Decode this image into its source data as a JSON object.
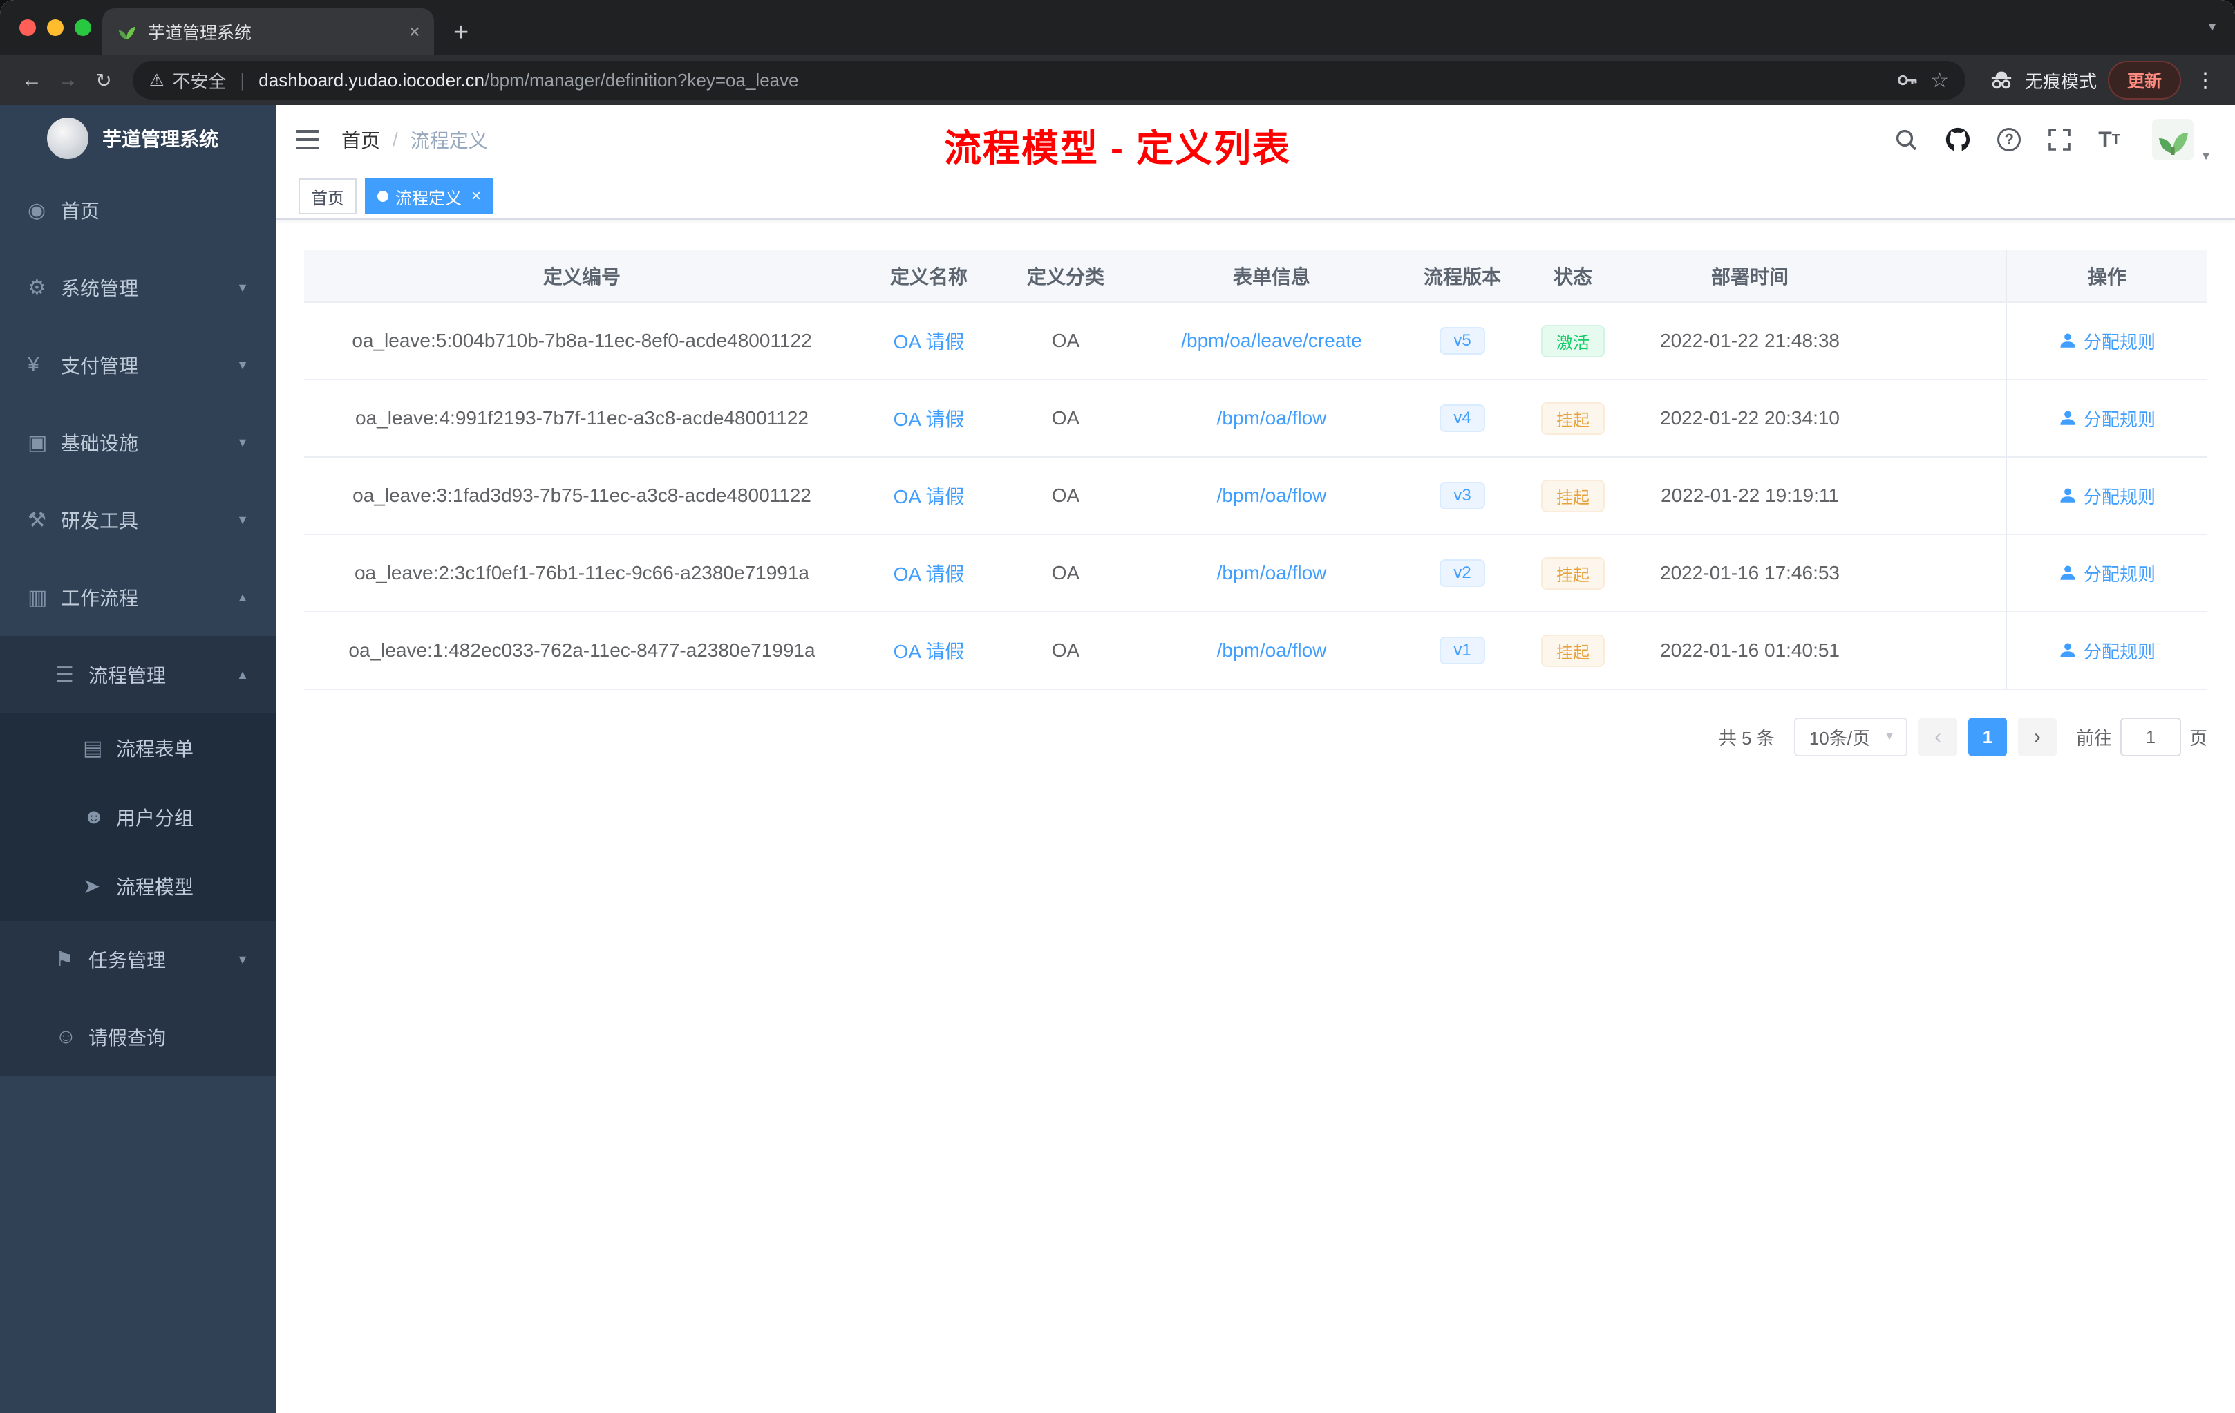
{
  "browser": {
    "tab_title": "芋道管理系统",
    "security_label": "不安全",
    "host": "dashboard.yudao.iocoder.cn",
    "path": "/bpm/manager/definition?key=oa_leave",
    "incognito_label": "无痕模式",
    "update_label": "更新"
  },
  "app": {
    "logo_title": "芋道管理系统",
    "breadcrumb_home": "首页",
    "breadcrumb_current": "流程定义",
    "annotation_title": "流程模型 - 定义列表",
    "tags": [
      {
        "label": "首页",
        "active": false
      },
      {
        "label": "流程定义",
        "active": true
      }
    ]
  },
  "sidebar": {
    "items": [
      {
        "name": "home",
        "label": "首页",
        "icon": "dashboard-icon",
        "glyph": "◉",
        "level": 1
      },
      {
        "name": "system-management",
        "label": "系统管理",
        "icon": "gear-icon",
        "glyph": "⚙",
        "level": 1,
        "arrow": "down"
      },
      {
        "name": "payment-management",
        "label": "支付管理",
        "icon": "yen-icon",
        "glyph": "¥",
        "level": 1,
        "arrow": "down"
      },
      {
        "name": "infrastructure",
        "label": "基础设施",
        "icon": "monitor-icon",
        "glyph": "▣",
        "level": 1,
        "arrow": "down"
      },
      {
        "name": "dev-tools",
        "label": "研发工具",
        "icon": "tools-icon",
        "glyph": "⚒",
        "level": 1,
        "arrow": "down"
      },
      {
        "name": "workflow",
        "label": "工作流程",
        "icon": "briefcase-icon",
        "glyph": "▥",
        "level": 1,
        "arrow": "up"
      },
      {
        "name": "process-management",
        "label": "流程管理",
        "icon": "list-icon",
        "glyph": "☰",
        "level": 2,
        "arrow": "up"
      },
      {
        "name": "process-form",
        "label": "流程表单",
        "icon": "document-icon",
        "glyph": "▤",
        "level": 3
      },
      {
        "name": "user-group",
        "label": "用户分组",
        "icon": "user-group-icon",
        "glyph": "☻",
        "level": 3
      },
      {
        "name": "process-model",
        "label": "流程模型",
        "icon": "paper-plane-icon",
        "glyph": "➤",
        "level": 3
      },
      {
        "name": "task-management",
        "label": "任务管理",
        "icon": "flag-icon",
        "glyph": "⚑",
        "level": 2,
        "arrow": "down"
      },
      {
        "name": "leave-query",
        "label": "请假查询",
        "icon": "user-icon",
        "glyph": "☺",
        "level": 2
      }
    ]
  },
  "table": {
    "columns": [
      "定义编号",
      "定义名称",
      "定义分类",
      "表单信息",
      "流程版本",
      "状态",
      "部署时间",
      "操作"
    ],
    "action_label": "分配规则",
    "rows": [
      {
        "id": "oa_leave:5:004b710b-7b8a-11ec-8ef0-acde48001122",
        "name": "OA 请假",
        "category": "OA",
        "form": "/bpm/oa/leave/create",
        "version": "v5",
        "status": "激活",
        "status_type": "success",
        "deployed": "2022-01-22 21:48:38"
      },
      {
        "id": "oa_leave:4:991f2193-7b7f-11ec-a3c8-acde48001122",
        "name": "OA 请假",
        "category": "OA",
        "form": "/bpm/oa/flow",
        "version": "v4",
        "status": "挂起",
        "status_type": "warning",
        "deployed": "2022-01-22 20:34:10"
      },
      {
        "id": "oa_leave:3:1fad3d93-7b75-11ec-a3c8-acde48001122",
        "name": "OA 请假",
        "category": "OA",
        "form": "/bpm/oa/flow",
        "version": "v3",
        "status": "挂起",
        "status_type": "warning",
        "deployed": "2022-01-22 19:19:11"
      },
      {
        "id": "oa_leave:2:3c1f0ef1-76b1-11ec-9c66-a2380e71991a",
        "name": "OA 请假",
        "category": "OA",
        "form": "/bpm/oa/flow",
        "version": "v2",
        "status": "挂起",
        "status_type": "warning",
        "deployed": "2022-01-16 17:46:53"
      },
      {
        "id": "oa_leave:1:482ec033-762a-11ec-8477-a2380e71991a",
        "name": "OA 请假",
        "category": "OA",
        "form": "/bpm/oa/flow",
        "version": "v1",
        "status": "挂起",
        "status_type": "warning",
        "deployed": "2022-01-16 01:40:51"
      }
    ]
  },
  "pagination": {
    "total": "共 5 条",
    "page_size": "10条/页",
    "page": "1",
    "goto_prefix": "前往",
    "goto_value": "1",
    "goto_suffix": "页"
  },
  "colors": {
    "accent": "#409eff",
    "success": "#13ce66",
    "warning": "#e6a23c",
    "annotation": "#ff0000",
    "sidebar": "#304156"
  }
}
